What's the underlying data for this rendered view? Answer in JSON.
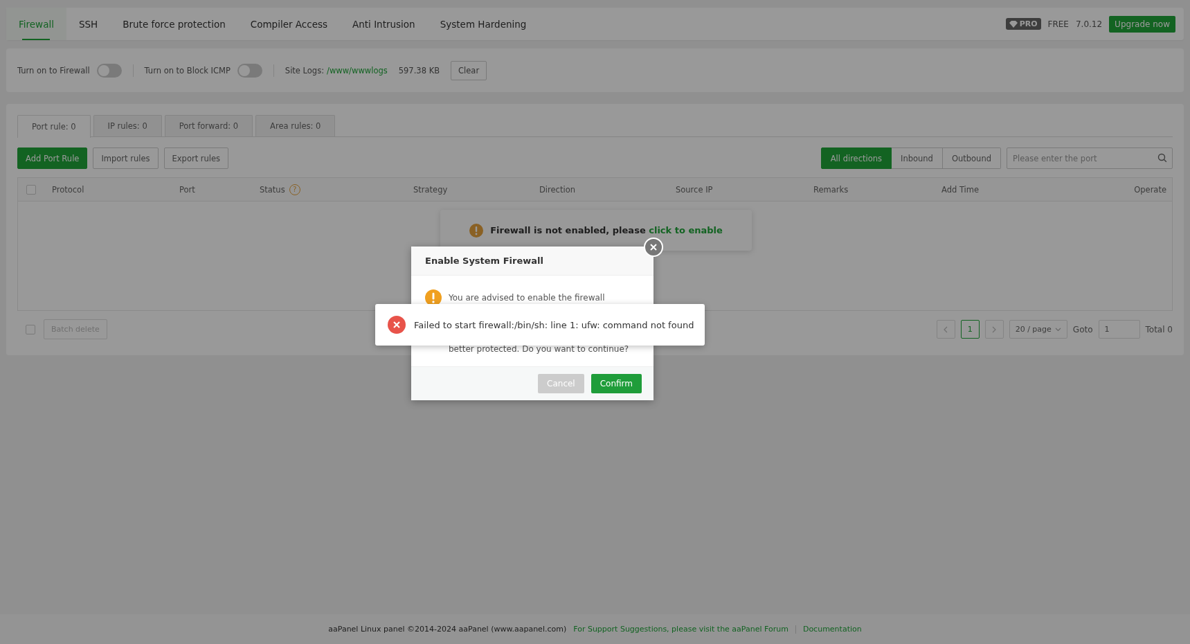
{
  "nav_tabs": [
    {
      "label": "Firewall",
      "selected": true
    },
    {
      "label": "SSH",
      "selected": false
    },
    {
      "label": "Brute force protection",
      "selected": false
    },
    {
      "label": "Compiler Access",
      "selected": false
    },
    {
      "label": "Anti Intrusion",
      "selected": false
    },
    {
      "label": "System Hardening",
      "selected": false
    }
  ],
  "edition": {
    "badge": "PRO",
    "plan": "FREE",
    "version": "7.0.12",
    "upgrade_button": "Upgrade now"
  },
  "toolbar": {
    "toggles": [
      {
        "label": "Turn on to Firewall",
        "on": false
      },
      {
        "label": "Turn on to Block ICMP",
        "on": false
      }
    ],
    "site_logs": {
      "label": "Site Logs:",
      "path": "/www/wwwlogs",
      "size": "597.38 KB"
    },
    "clear_button": "Clear"
  },
  "rule_tabs": [
    {
      "label": "Port rule: 0",
      "selected": true
    },
    {
      "label": "IP rules: 0",
      "selected": false
    },
    {
      "label": "Port forward: 0",
      "selected": false
    },
    {
      "label": "Area rules: 0",
      "selected": false
    }
  ],
  "actions": [
    {
      "label": "Add Port Rule",
      "kind": "primary"
    },
    {
      "label": "Import rules",
      "kind": "plain"
    },
    {
      "label": "Export rules",
      "kind": "plain"
    }
  ],
  "direction_filter": [
    {
      "label": "All directions",
      "selected": true
    },
    {
      "label": "Inbound",
      "selected": false
    },
    {
      "label": "Outbound",
      "selected": false
    }
  ],
  "search": {
    "placeholder": "Please enter the port"
  },
  "table": {
    "select_all_checked": false,
    "columns": [
      {
        "label": "Protocol"
      },
      {
        "label": "Port"
      },
      {
        "label": "Status",
        "hint": "?"
      },
      {
        "label": "Strategy"
      },
      {
        "label": "Direction"
      },
      {
        "label": "Source IP"
      },
      {
        "label": "Remarks"
      },
      {
        "label": "Add Time"
      },
      {
        "label": "Operate"
      }
    ]
  },
  "batch": {
    "checked": false,
    "button": "Batch delete"
  },
  "pagination": {
    "pages": [
      {
        "label": "1",
        "selected": true
      }
    ],
    "page_size": "20 / page",
    "goto_label": "Goto",
    "goto_value": "1",
    "total": "Total 0"
  },
  "notice": {
    "text": "Firewall is not enabled, please ",
    "link": "click to enable"
  },
  "dialog": {
    "title": "Enable System Firewall",
    "message_lines": [
      "You are advised to enable the firewall",
      "better protected. Do you want to continue?"
    ],
    "buttons": [
      {
        "label": "Cancel",
        "kind": "secondary"
      },
      {
        "label": "Confirm",
        "kind": "primary"
      }
    ]
  },
  "toast": {
    "text": "Failed to start firewall:/bin/sh: line 1: ufw: command not found"
  },
  "footer": {
    "copyright": "aaPanel Linux panel ©2014-2024 aaPanel (www.aapanel.com)",
    "links": [
      "For Support Suggestions, please visit the aaPanel Forum",
      "Documentation"
    ]
  }
}
